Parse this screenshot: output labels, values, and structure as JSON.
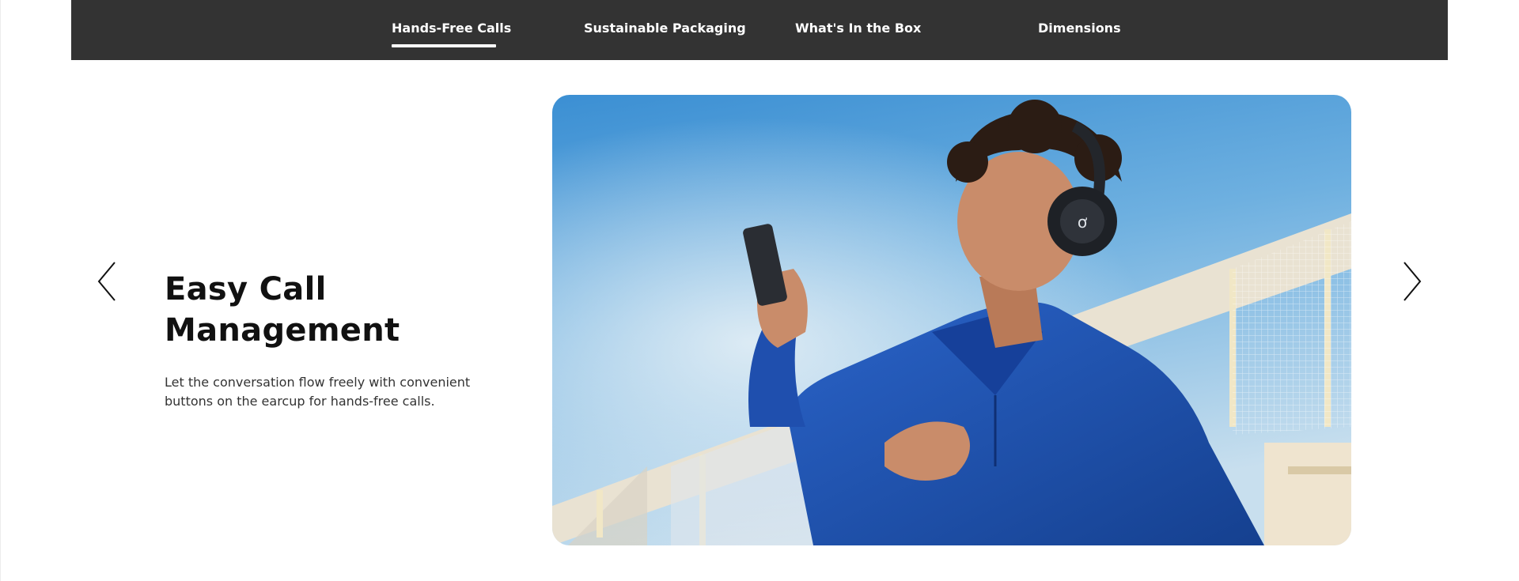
{
  "tabs": [
    {
      "label": "Hands-Free Calls",
      "active": true
    },
    {
      "label": "Sustainable Packaging",
      "active": false
    },
    {
      "label": "What's In the Box",
      "active": false
    },
    {
      "label": "Dimensions",
      "active": false
    }
  ],
  "slide": {
    "title": "Easy Call Management",
    "description": "Let the conversation flow freely with convenient buttons on the earcup for hands-free calls."
  },
  "colors": {
    "tabbar_bg": "#333333",
    "tab_text": "#ffffff",
    "headline": "#111111",
    "body_text": "#333333",
    "sweater": "#1f4fae",
    "sky_top": "#2f87cf"
  },
  "icons": {
    "prev": "chevron-left-icon",
    "next": "chevron-right-icon"
  }
}
